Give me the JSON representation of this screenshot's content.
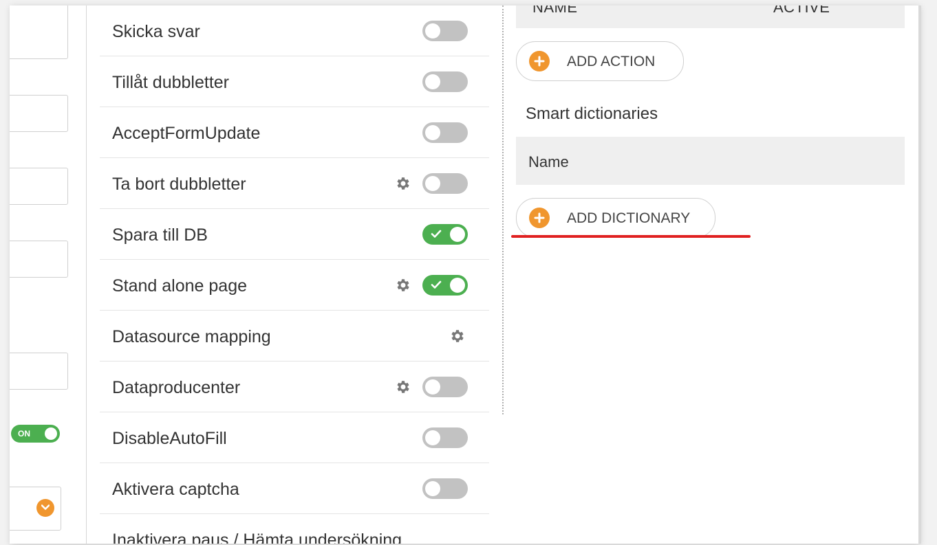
{
  "settings": {
    "rows": [
      {
        "label": "Skicka svar"
      },
      {
        "label": "Tillåt dubbletter"
      },
      {
        "label": "AcceptFormUpdate"
      },
      {
        "label": "Ta bort dubbletter"
      },
      {
        "label": "Spara till DB"
      },
      {
        "label": "Stand alone page"
      },
      {
        "label": "Datasource mapping"
      },
      {
        "label": "Dataproducenter"
      },
      {
        "label": "DisableAutoFill"
      },
      {
        "label": "Aktivera captcha"
      },
      {
        "label": "Inaktivera paus / Hämta undersökning"
      }
    ],
    "toggle_states": {
      "skicka_svar": "off",
      "tillat_dubbletter": "off",
      "accept_form_update": "off",
      "ta_bort_dubbletter": "off",
      "spara_till_db": "on",
      "stand_alone_page": "on",
      "dataproducenter": "off",
      "disable_auto_fill": "off",
      "aktivera_captcha": "off"
    }
  },
  "left": {
    "on_toggle_label": "ON"
  },
  "actions": {
    "columns": [
      "NAME",
      "ACTIVE"
    ],
    "add_label": "ADD ACTION"
  },
  "dictionaries": {
    "title": "Smart dictionaries",
    "columns": [
      "Name"
    ],
    "add_label": "ADD DICTIONARY"
  },
  "colors": {
    "accent_orange": "#f0962e",
    "toggle_on": "#4caf50",
    "toggle_off": "#c2c2c2",
    "highlight_underline": "#e02020"
  },
  "icons": {
    "settings": "gear-icon",
    "add": "plus-circle-icon",
    "dropdown": "chevron-down-icon",
    "toggle_checked": "check-icon"
  }
}
